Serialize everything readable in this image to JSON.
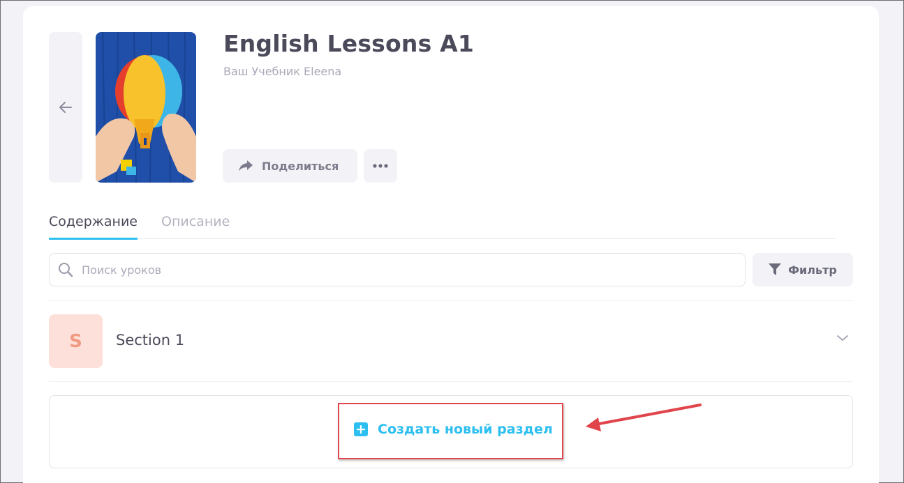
{
  "book": {
    "title": "English Lessons A1",
    "subtitle": "Ваш Учебник Eleena"
  },
  "actions": {
    "share_label": "Поделиться",
    "more_icon": "more-horizontal-icon"
  },
  "tabs": [
    {
      "label": "Содержание",
      "active": true
    },
    {
      "label": "Описание",
      "active": false
    }
  ],
  "search": {
    "placeholder": "Поиск уроков",
    "value": ""
  },
  "filter": {
    "label": "Фильтр"
  },
  "sections": [
    {
      "initial": "S",
      "title": "Section 1",
      "avatar_bg": "#fde0d9",
      "avatar_fg": "#f19a83"
    }
  ],
  "create_section": {
    "label": "Создать новый раздел"
  },
  "colors": {
    "accent": "#2cbff0",
    "annotation": "#e0454b"
  }
}
